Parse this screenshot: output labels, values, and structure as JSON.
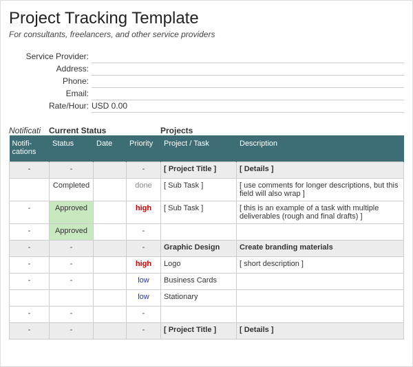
{
  "header": {
    "title": "Project Tracking Template",
    "subtitle": "For consultants, freelancers, and other service providers"
  },
  "info": {
    "rows": [
      {
        "label": "Service Provider:",
        "value": ""
      },
      {
        "label": "Address:",
        "value": ""
      },
      {
        "label": "Phone:",
        "value": ""
      },
      {
        "label": "Email:",
        "value": ""
      },
      {
        "label": "Rate/Hour:",
        "value": "USD 0.00"
      }
    ]
  },
  "section_labels": {
    "notifications": "Notificati",
    "status": "Current Status",
    "projects": "Projects"
  },
  "columns": {
    "notifications": "Notifi- cations",
    "status": "Status",
    "date": "Date",
    "priority": "Priority",
    "project": "Project / Task",
    "description": "Description"
  },
  "rows": [
    {
      "n": "-",
      "s": "-",
      "d": "",
      "p": "-",
      "proj": "[ Project Title ]",
      "desc": "[ Details ]",
      "shaded": true,
      "bold": true
    },
    {
      "n": "",
      "s": "Completed",
      "d": "",
      "p": "done",
      "pClass": "done",
      "proj": "[ Sub Task ]",
      "desc": "[ use comments for longer descriptions, but this field will also wrap ]"
    },
    {
      "n": "-",
      "s": "Approved",
      "sClass": "approved",
      "d": "",
      "p": "high",
      "pClass": "high",
      "proj": "[ Sub Task ]",
      "desc": "[ this is an example of a task with multiple deliverables (rough and final drafts) ]"
    },
    {
      "n": "-",
      "s": "Approved",
      "sClass": "approved",
      "d": "",
      "p": "-",
      "proj": "",
      "desc": ""
    },
    {
      "n": "-",
      "s": "-",
      "d": "",
      "p": "-",
      "proj": "Graphic Design",
      "desc": "Create branding materials",
      "shaded": true,
      "bold": true
    },
    {
      "n": "-",
      "s": "-",
      "d": "",
      "p": "high",
      "pClass": "high",
      "proj": "Logo",
      "desc": "[ short description ]"
    },
    {
      "n": "-",
      "s": "-",
      "d": "",
      "p": "low",
      "pClass": "low",
      "proj": "Business Cards",
      "desc": ""
    },
    {
      "n": "",
      "s": "",
      "d": "",
      "p": "low",
      "pClass": "low",
      "proj": "Stationary",
      "desc": ""
    },
    {
      "n": "-",
      "s": "-",
      "d": "",
      "p": "-",
      "proj": "",
      "desc": ""
    },
    {
      "n": "-",
      "s": "-",
      "d": "",
      "p": "-",
      "proj": "[ Project Title ]",
      "desc": "[ Details ]",
      "shaded": true,
      "bold": true
    }
  ]
}
